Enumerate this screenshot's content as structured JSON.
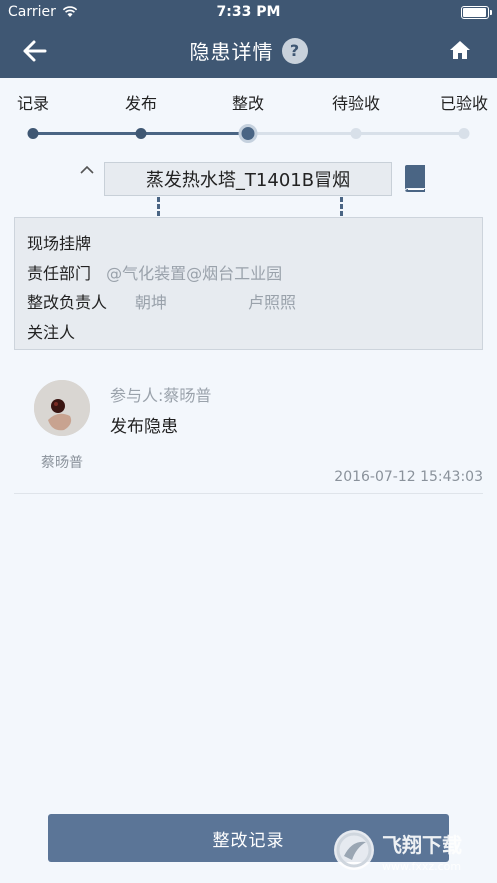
{
  "status_bar": {
    "carrier": "Carrier",
    "time": "7:33 PM"
  },
  "nav": {
    "title": "隐患详情",
    "help_label": "?"
  },
  "steps": [
    {
      "label": "记录",
      "state": "done"
    },
    {
      "label": "发布",
      "state": "done"
    },
    {
      "label": "整改",
      "state": "current"
    },
    {
      "label": "待验收",
      "state": "todo"
    },
    {
      "label": "已验收",
      "state": "todo"
    }
  ],
  "hazard": {
    "title": "蒸发热水塔_T1401B冒烟"
  },
  "info": {
    "site_tag_label": "现场挂牌",
    "department_label": "责任部门",
    "department_value": "@气化装置@烟台工业园",
    "owner_label": "整改负责人",
    "owner_1": "朝坤",
    "owner_2": "卢照照",
    "follower_label": "关注人"
  },
  "record": {
    "avatar_name": "蔡旸普",
    "participant": "参与人:蔡旸普",
    "action": "发布隐患",
    "timestamp": "2016-07-12 15:43:03"
  },
  "bottom_button": {
    "label": "整改记录"
  },
  "watermark": {
    "text": "飞翔下载",
    "url": "www.fxxz.com"
  },
  "colors": {
    "nav": "#3f5773",
    "accent": "#5b7597",
    "background": "#f3f7fc"
  }
}
